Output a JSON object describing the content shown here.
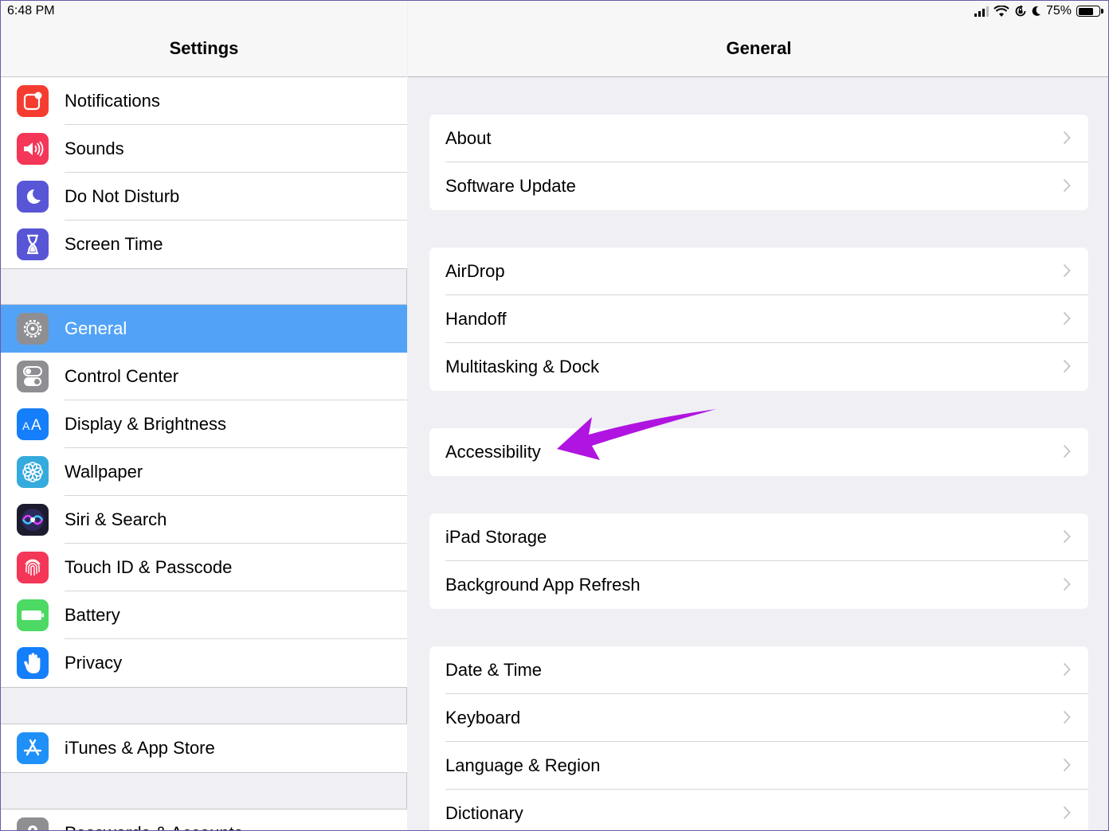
{
  "status_bar": {
    "time": "6:48 PM",
    "battery": "75%"
  },
  "left_pane": {
    "title": "Settings",
    "groups": [
      [
        {
          "label": "Notifications",
          "icon": "notifications-icon",
          "color": "#f53c30"
        },
        {
          "label": "Sounds",
          "icon": "sounds-icon",
          "color": "#f43658"
        },
        {
          "label": "Do Not Disturb",
          "icon": "moon-icon",
          "color": "#5856d6"
        },
        {
          "label": "Screen Time",
          "icon": "hourglass-icon",
          "color": "#5856d6"
        }
      ],
      [
        {
          "label": "General",
          "icon": "gear-icon",
          "color": "#8e8e93",
          "selected": true
        },
        {
          "label": "Control Center",
          "icon": "toggles-icon",
          "color": "#8e8e93"
        },
        {
          "label": "Display & Brightness",
          "icon": "text-size-icon",
          "color": "#157efb"
        },
        {
          "label": "Wallpaper",
          "icon": "flower-icon",
          "color": "#35aadc"
        },
        {
          "label": "Siri & Search",
          "icon": "siri-icon",
          "color": "#1c1c2e"
        },
        {
          "label": "Touch ID & Passcode",
          "icon": "fingerprint-icon",
          "color": "#f43658"
        },
        {
          "label": "Battery",
          "icon": "battery-icon",
          "color": "#4cd964"
        },
        {
          "label": "Privacy",
          "icon": "hand-icon",
          "color": "#157efb"
        }
      ],
      [
        {
          "label": "iTunes & App Store",
          "icon": "app-store-icon",
          "color": "#1e90f8"
        }
      ],
      [
        {
          "label": "Passwords & Accounts",
          "icon": "key-icon",
          "color": "#8e8e93"
        }
      ]
    ]
  },
  "right_pane": {
    "title": "General",
    "groups": [
      [
        "About",
        "Software Update"
      ],
      [
        "AirDrop",
        "Handoff",
        "Multitasking & Dock"
      ],
      [
        "Accessibility"
      ],
      [
        "iPad Storage",
        "Background App Refresh"
      ],
      [
        "Date & Time",
        "Keyboard",
        "Language & Region",
        "Dictionary"
      ]
    ]
  },
  "annotation": {
    "color": "#b014e0"
  }
}
